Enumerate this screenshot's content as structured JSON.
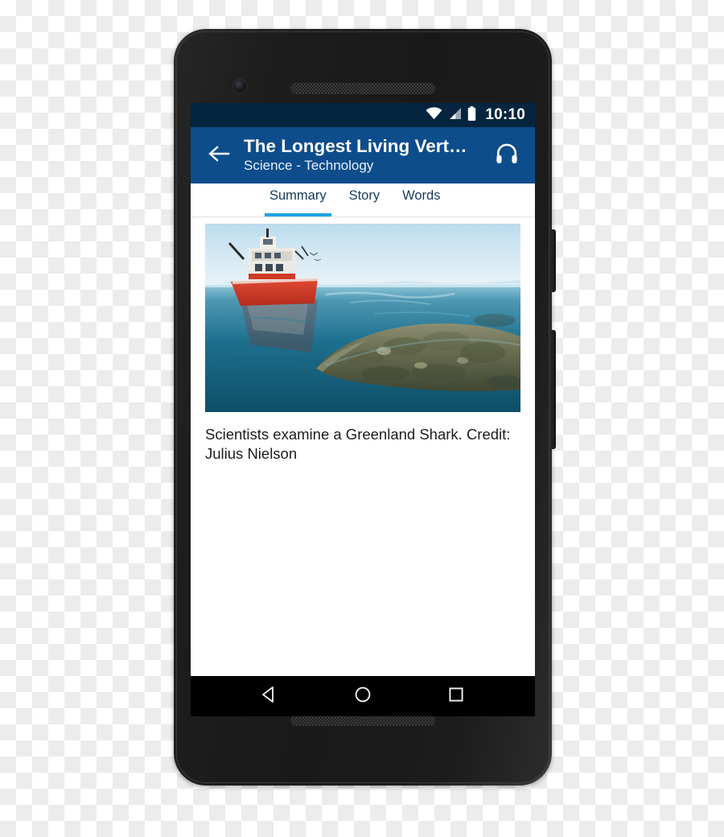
{
  "device": {
    "name": "android-smartphone",
    "front_camera": "camera-icon",
    "earpiece": "speaker-grille",
    "bottom_speaker": "speaker-grille",
    "power_button": "power-button",
    "volume_rocker": "volume-rocker"
  },
  "status_bar": {
    "clock": "10:10",
    "wifi_icon": "wifi-icon",
    "signal_icon": "cellular-signal-icon",
    "battery_icon": "battery-icon",
    "background": "#04243f"
  },
  "app_bar": {
    "back_icon": "back-arrow-icon",
    "title": "The Longest Living Vert…",
    "subtitle": "Science - Technology",
    "audio_icon": "headphones-icon",
    "background": "#0d4d8c"
  },
  "tabs": {
    "active_index": 0,
    "accent": "#1fa2e6",
    "items": [
      {
        "label": "Summary"
      },
      {
        "label": "Story"
      },
      {
        "label": "Words"
      }
    ]
  },
  "content": {
    "photo": {
      "name": "greenland-shark-photo",
      "alt": "Research vessel and a Greenland shark at the ocean surface"
    },
    "caption": "Scientists examine a Greenland Shark. Credit: Julius Nielson"
  },
  "nav_bar": {
    "back_icon": "nav-back-triangle-icon",
    "home_icon": "nav-home-circle-icon",
    "recents_icon": "nav-recents-square-icon"
  }
}
